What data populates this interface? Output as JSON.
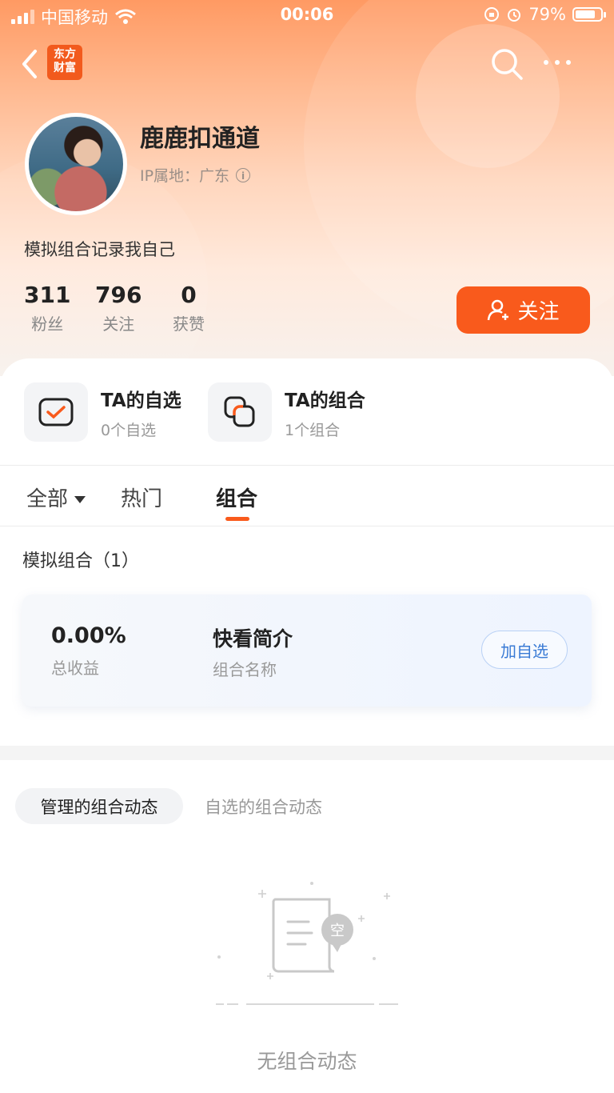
{
  "status_bar": {
    "carrier": "中国移动",
    "time": "00:06",
    "battery": "79%"
  },
  "nav": {
    "logo_line1": "东方",
    "logo_line2": "财富"
  },
  "profile": {
    "name": "鹿鹿扣通道",
    "ip": "IP属地：广东",
    "bio": "模拟组合记录我自己",
    "stats": [
      {
        "value": "311",
        "label": "粉丝"
      },
      {
        "value": "796",
        "label": "关注"
      },
      {
        "value": "0",
        "label": "获赞"
      }
    ],
    "follow_label": "关注"
  },
  "quick": [
    {
      "title": "TA的自选",
      "sub": "0个自选",
      "icon": "watchlist-check-icon"
    },
    {
      "title": "TA的组合",
      "sub": "1个组合",
      "icon": "portfolio-icon"
    }
  ],
  "tabs": [
    {
      "label": "全部"
    },
    {
      "label": "热门"
    },
    {
      "label": "组合"
    }
  ],
  "combo_section": {
    "title": "模拟组合（1）",
    "card": {
      "return_value": "0.00%",
      "return_label": "总收益",
      "name": "快看简介",
      "name_label": "组合名称",
      "add_label": "加自选"
    }
  },
  "dynamics": {
    "tab_active": "管理的组合动态",
    "tab_other": "自选的组合动态",
    "empty_badge": "空",
    "empty_text": "无组合动态"
  },
  "colors": {
    "accent": "#f95a1c",
    "blue": "#3a7bd5"
  }
}
